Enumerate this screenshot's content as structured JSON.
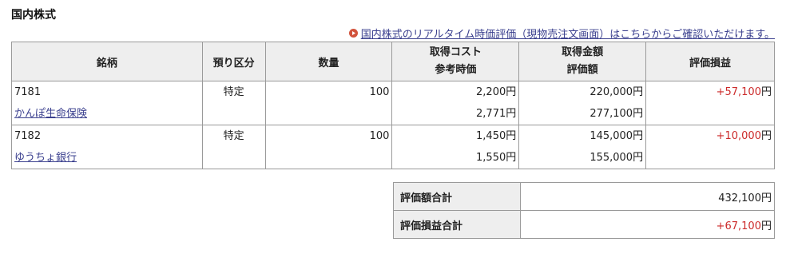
{
  "section_title": "国内株式",
  "realtime_link": "国内株式のリアルタイム時価評価（現物売注文画面）はこちらからご確認いただけます。",
  "columns": {
    "name": "銘柄",
    "account": "預り区分",
    "quantity": "数量",
    "cost_line1": "取得コスト",
    "cost_line2": "参考時価",
    "amount_line1": "取得金額",
    "amount_line2": "評価額",
    "pl": "評価損益"
  },
  "unit": "円",
  "holdings": [
    {
      "code": "7181",
      "name": "かんぽ生命保険",
      "account": "特定",
      "quantity": "100",
      "cost": "2,200",
      "ref_price": "2,771",
      "acq_amount": "220,000",
      "valuation": "277,100",
      "pl": "+57,100"
    },
    {
      "code": "7182",
      "name": "ゆうちょ銀行",
      "account": "特定",
      "quantity": "100",
      "cost": "1,450",
      "ref_price": "1,550",
      "acq_amount": "145,000",
      "valuation": "155,000",
      "pl": "+10,000"
    }
  ],
  "summary": {
    "valuation_total_label": "評価額合計",
    "valuation_total": "432,100",
    "pl_total_label": "評価損益合計",
    "pl_total": "+67,100"
  },
  "colors": {
    "link": "#3a3f8e",
    "gain": "#cc2b2b",
    "bullet": "#d2533c",
    "header_bg": "#eeeeee"
  }
}
